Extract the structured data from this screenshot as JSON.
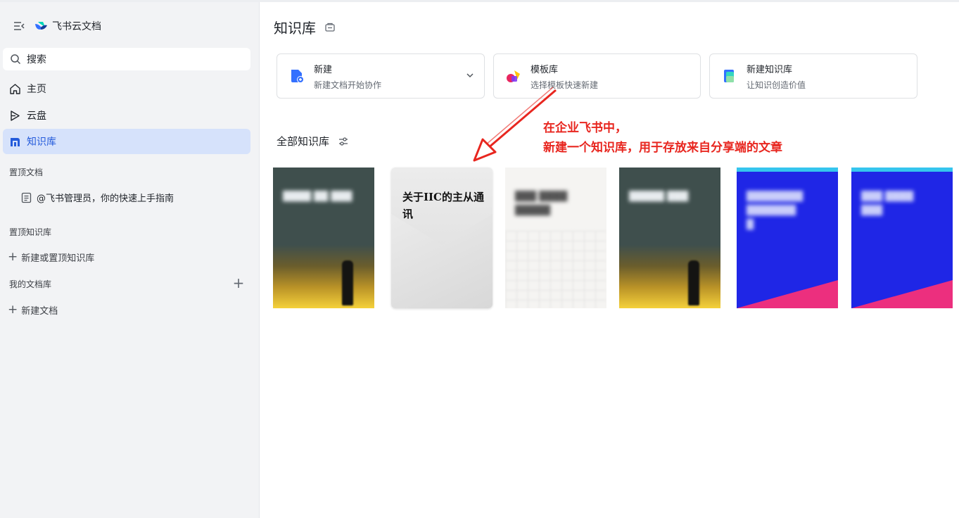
{
  "sidebar": {
    "brand": "飞书云文档",
    "search_label": "搜索",
    "nav": [
      {
        "label": "主页",
        "icon": "home-icon"
      },
      {
        "label": "云盘",
        "icon": "cloud-drive-icon"
      },
      {
        "label": "知识库",
        "icon": "wiki-icon",
        "active": true
      }
    ],
    "pinned_docs_label": "置顶文档",
    "pinned_doc": "@飞书管理员，你的快速上手指南",
    "pinned_libs_label": "置顶知识库",
    "new_or_pin_lib": "新建或置顶知识库",
    "my_libs_label": "我的文档库",
    "new_doc": "新建文档"
  },
  "main": {
    "title": "知识库",
    "cards": [
      {
        "title": "新建",
        "subtitle": "新建文档开始协作",
        "icon": "new-doc-icon"
      },
      {
        "title": "模板库",
        "subtitle": "选择模板快速新建",
        "icon": "template-icon"
      },
      {
        "title": "新建知识库",
        "subtitle": "让知识创造价值",
        "icon": "new-wiki-icon"
      }
    ],
    "all_libs_label": "全部知识库",
    "annotation": [
      "在企业飞书中，",
      "新建一个知识库，用于存放来自分享端的文章"
    ],
    "libraries": [
      {
        "title": "关于IIC的主从通讯",
        "style": "paper"
      }
    ]
  },
  "colors": {
    "accent": "#245bdb",
    "active_bg": "#d6e2fb",
    "annotation_red": "#e8261f"
  }
}
